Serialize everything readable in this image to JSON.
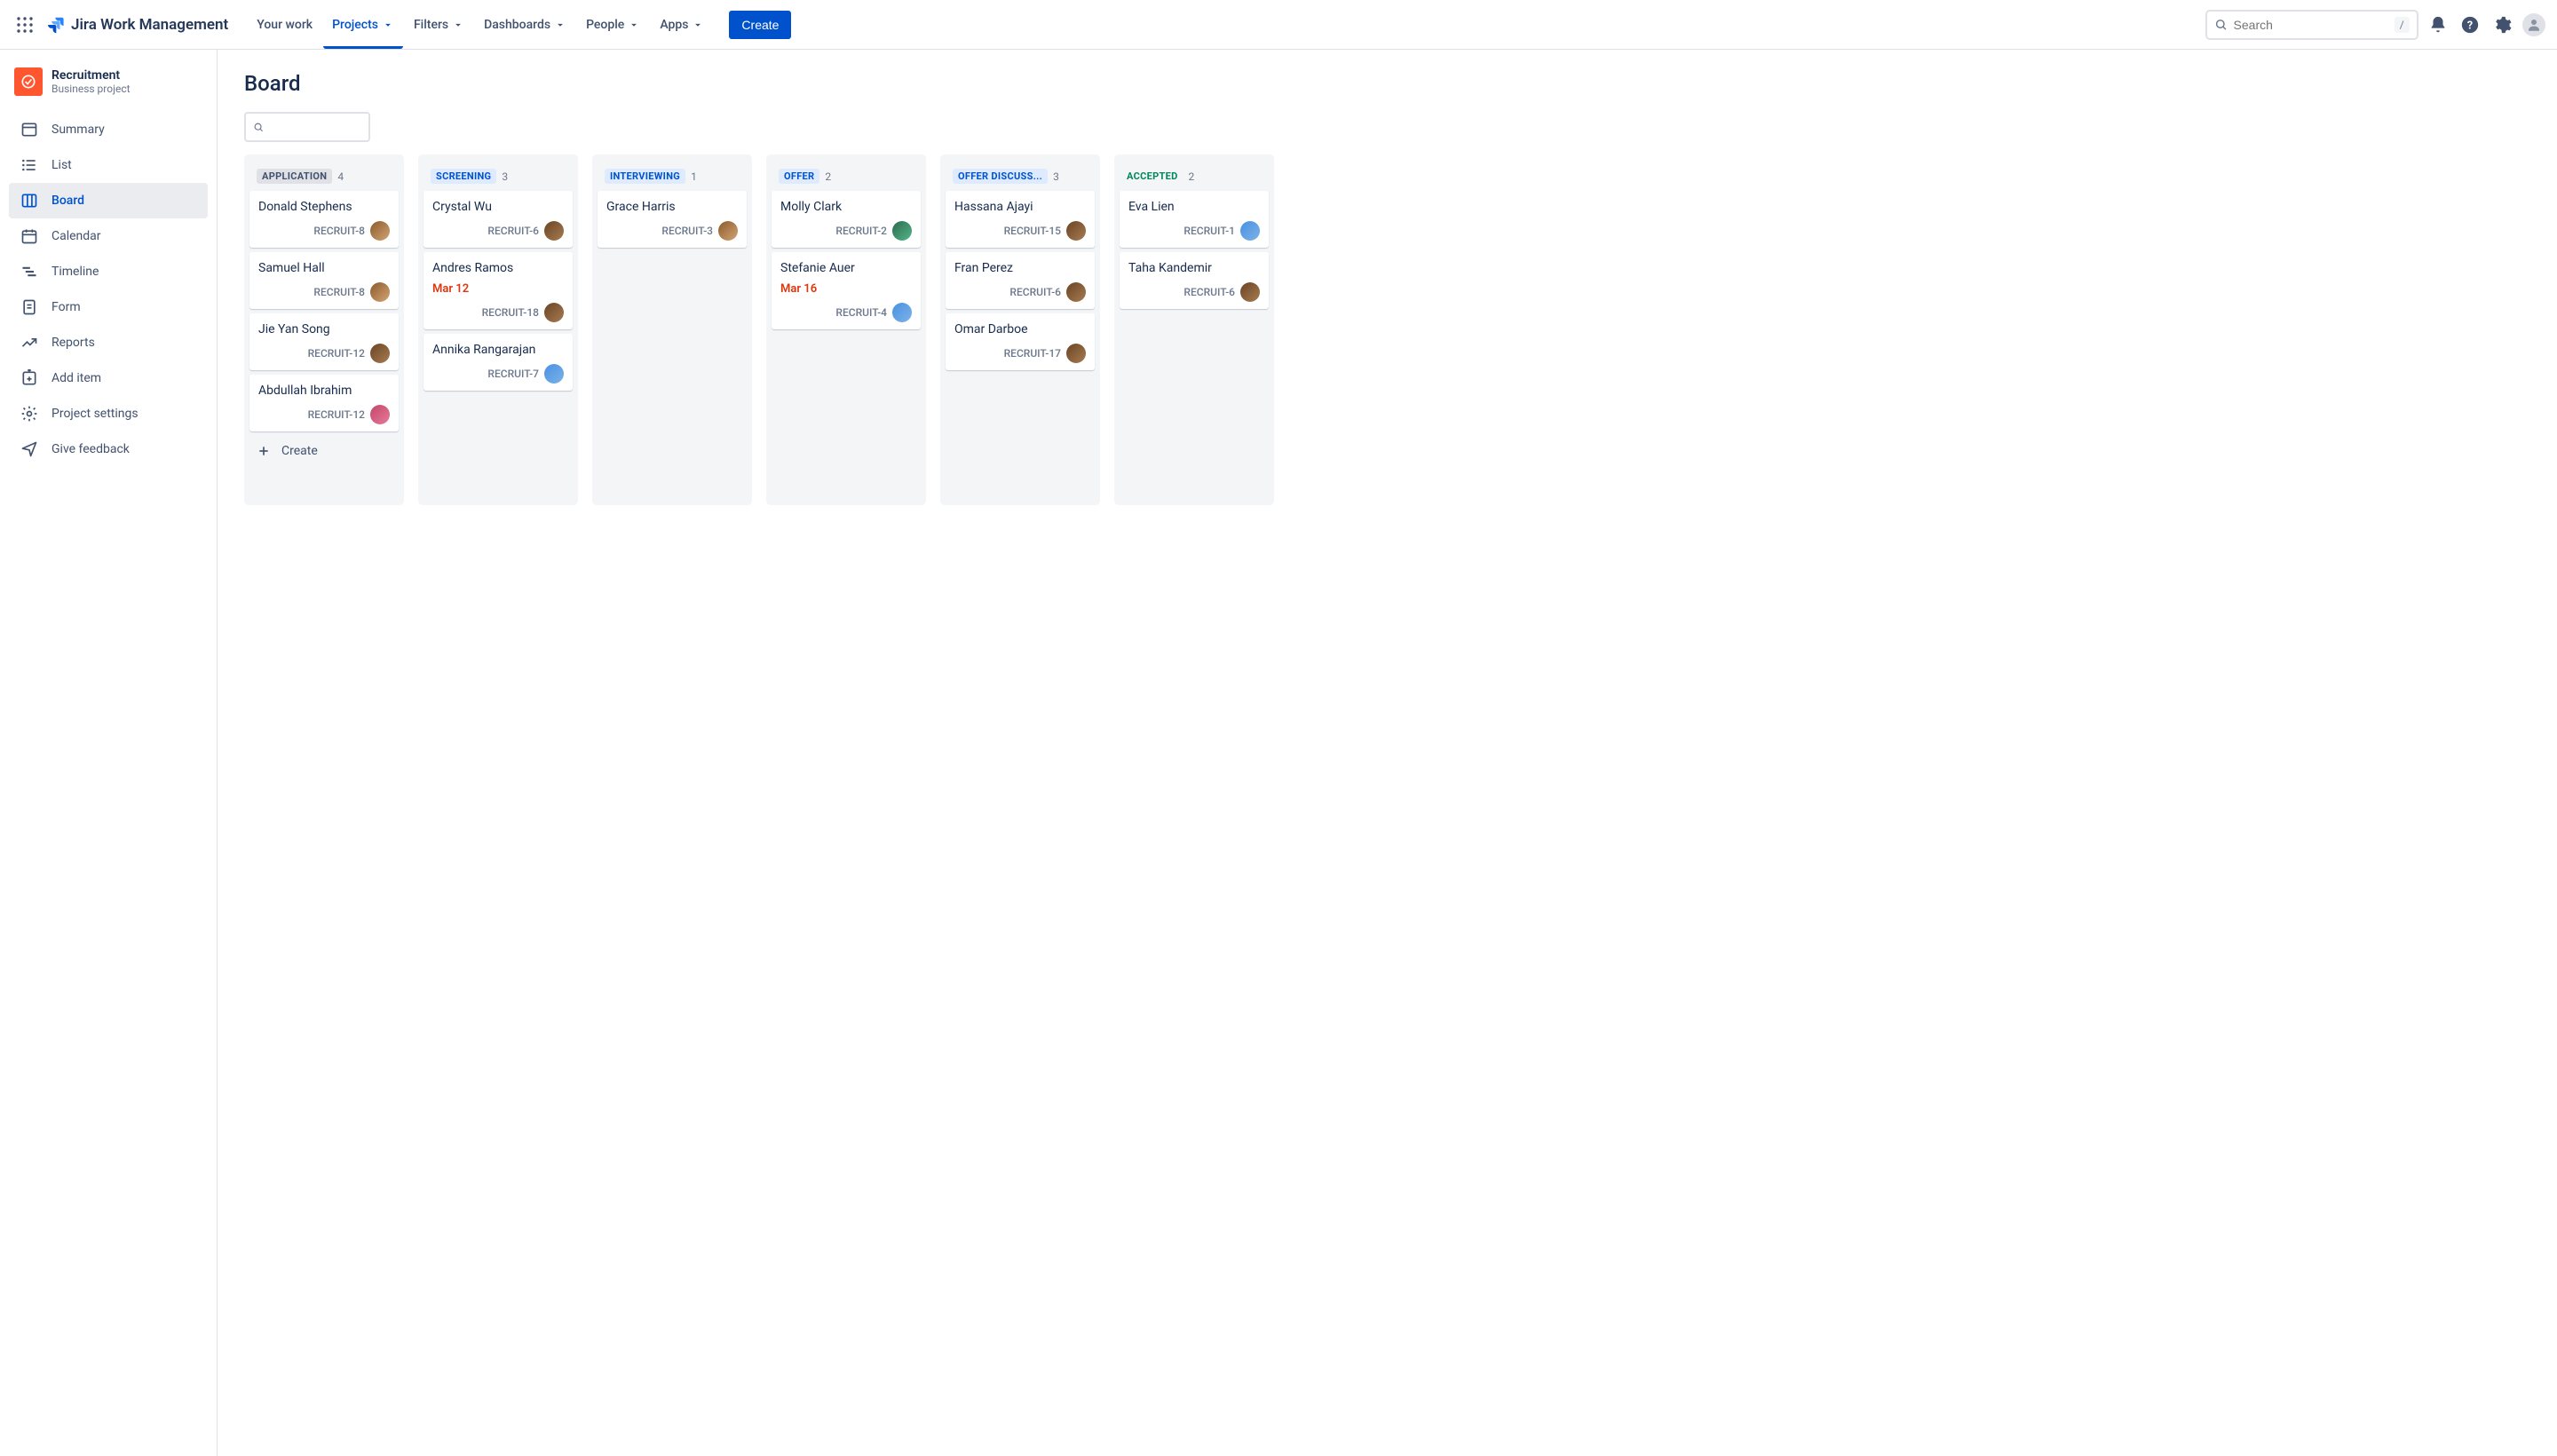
{
  "app_name": "Jira Work Management",
  "nav": {
    "items": [
      {
        "label": "Your work",
        "dropdown": false,
        "active": false
      },
      {
        "label": "Projects",
        "dropdown": true,
        "active": true
      },
      {
        "label": "Filters",
        "dropdown": true,
        "active": false
      },
      {
        "label": "Dashboards",
        "dropdown": true,
        "active": false
      },
      {
        "label": "People",
        "dropdown": true,
        "active": false
      },
      {
        "label": "Apps",
        "dropdown": true,
        "active": false
      }
    ],
    "create_label": "Create"
  },
  "search": {
    "placeholder": "Search",
    "shortcut": "/"
  },
  "project": {
    "name": "Recruitment",
    "subtitle": "Business project"
  },
  "sidebar": {
    "items": [
      {
        "label": "Summary",
        "icon": "layout"
      },
      {
        "label": "List",
        "icon": "list"
      },
      {
        "label": "Board",
        "icon": "board",
        "active": true
      },
      {
        "label": "Calendar",
        "icon": "calendar"
      },
      {
        "label": "Timeline",
        "icon": "timeline"
      },
      {
        "label": "Form",
        "icon": "form"
      },
      {
        "label": "Reports",
        "icon": "reports"
      },
      {
        "label": "Add item",
        "icon": "add-item"
      },
      {
        "label": "Project settings",
        "icon": "settings"
      },
      {
        "label": "Give feedback",
        "icon": "feedback"
      }
    ]
  },
  "page": {
    "title": "Board",
    "create_card_label": "Create"
  },
  "columns": [
    {
      "title": "APPLICATION",
      "count": 4,
      "status": "todo",
      "show_create": true,
      "cards": [
        {
          "title": "Donald Stephens",
          "key": "RECRUIT-8",
          "avatar": "a"
        },
        {
          "title": "Samuel Hall",
          "key": "RECRUIT-8",
          "avatar": "a"
        },
        {
          "title": "Jie Yan Song",
          "key": "RECRUIT-12",
          "avatar": "d"
        },
        {
          "title": "Abdullah Ibrahim",
          "key": "RECRUIT-12",
          "avatar": "c"
        }
      ]
    },
    {
      "title": "SCREENING",
      "count": 3,
      "status": "inprogress",
      "cards": [
        {
          "title": "Crystal Wu",
          "key": "RECRUIT-6",
          "avatar": "d"
        },
        {
          "title": "Andres Ramos",
          "date": "Mar 12",
          "key": "RECRUIT-18",
          "avatar": "d"
        },
        {
          "title": "Annika Rangarajan",
          "key": "RECRUIT-7",
          "avatar": "b"
        }
      ]
    },
    {
      "title": "INTERVIEWING",
      "count": 1,
      "status": "inprogress",
      "cards": [
        {
          "title": "Grace Harris",
          "key": "RECRUIT-3",
          "avatar": "a"
        }
      ]
    },
    {
      "title": "OFFER",
      "count": 2,
      "status": "inprogress",
      "cards": [
        {
          "title": "Molly Clark",
          "key": "RECRUIT-2",
          "avatar": "e"
        },
        {
          "title": "Stefanie Auer",
          "date": "Mar 16",
          "key": "RECRUIT-4",
          "avatar": "b"
        }
      ]
    },
    {
      "title": "OFFER DISCUSS...",
      "count": 3,
      "status": "inprogress",
      "cards": [
        {
          "title": "Hassana Ajayi",
          "key": "RECRUIT-15",
          "avatar": "d"
        },
        {
          "title": "Fran Perez",
          "key": "RECRUIT-6",
          "avatar": "d"
        },
        {
          "title": "Omar Darboe",
          "key": "RECRUIT-17",
          "avatar": "d"
        }
      ]
    },
    {
      "title": "ACCEPTED",
      "count": 2,
      "status": "done",
      "cards": [
        {
          "title": "Eva Lien",
          "key": "RECRUIT-1",
          "avatar": "b"
        },
        {
          "title": "Taha Kandemir",
          "key": "RECRUIT-6",
          "avatar": "d"
        }
      ]
    }
  ]
}
